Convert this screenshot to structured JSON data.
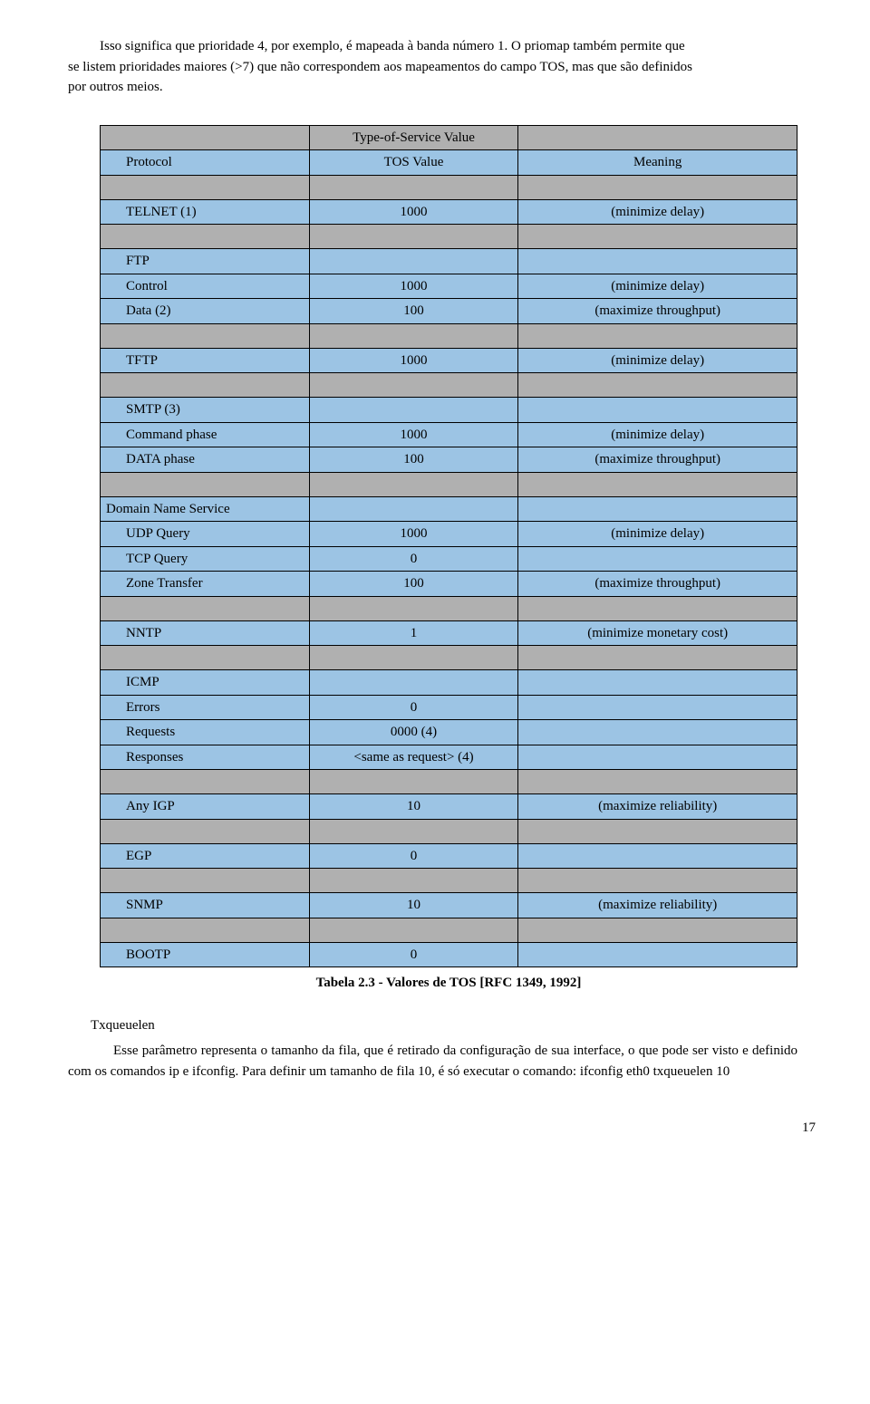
{
  "intro": {
    "l1": "Isso significa que prioridade 4, por exemplo, é mapeada à banda número 1. O priomap também permite que",
    "l2": "se listem prioridades maiores (>7) que não correspondem aos mapeamentos do campo TOS, mas que são definidos",
    "l3": "por outros meios."
  },
  "header": {
    "title": "Type-of-Service Value",
    "col1": "Protocol",
    "col2": "TOS Value",
    "col3": "Meaning"
  },
  "rows": {
    "telnet": {
      "c1": "TELNET (1)",
      "c2": "1000",
      "c3": "(minimize delay)"
    },
    "ftp": {
      "c1": "FTP"
    },
    "ftp_control": {
      "c1": "Control",
      "c2": "1000",
      "c3": "(minimize delay)"
    },
    "ftp_data": {
      "c1": "Data (2)",
      "c2": "100",
      "c3": "(maximize throughput)"
    },
    "tftp": {
      "c1": "TFTP",
      "c2": "1000",
      "c3": "(minimize delay)"
    },
    "smtp": {
      "c1": "SMTP (3)"
    },
    "smtp_cmd": {
      "c1": "Command phase",
      "c2": "1000",
      "c3": "(minimize delay)"
    },
    "smtp_data": {
      "c1": "DATA phase",
      "c2": "100",
      "c3": "(maximize throughput)"
    },
    "dns": {
      "c1": "Domain Name Service"
    },
    "dns_udp": {
      "c1": "UDP Query",
      "c2": "1000",
      "c3": "(minimize delay)"
    },
    "dns_tcp": {
      "c1": "TCP Query",
      "c2": "0",
      "c3": ""
    },
    "dns_zone": {
      "c1": "Zone Transfer",
      "c2": "100",
      "c3": "(maximize throughput)"
    },
    "nntp": {
      "c1": "NNTP",
      "c2": "1",
      "c3": "(minimize monetary cost)"
    },
    "icmp": {
      "c1": "ICMP"
    },
    "icmp_err": {
      "c1": "Errors",
      "c2": "0",
      "c3": ""
    },
    "icmp_req": {
      "c1": "Requests",
      "c2": "0000 (4)",
      "c3": ""
    },
    "icmp_resp": {
      "c1": "Responses",
      "c2": "<same as request> (4)",
      "c3": ""
    },
    "anyigp": {
      "c1": "Any IGP",
      "c2": "10",
      "c3": "(maximize reliability)"
    },
    "egp": {
      "c1": "EGP",
      "c2": "0",
      "c3": ""
    },
    "snmp": {
      "c1": "SNMP",
      "c2": "10",
      "c3": "(maximize reliability)"
    },
    "bootp": {
      "c1": "BOOTP",
      "c2": "0",
      "c3": ""
    }
  },
  "caption": "Tabela 2.3 - Valores de TOS [RFC 1349, 1992]",
  "section": {
    "title": "Txqueuelen",
    "p1": "Esse parâmetro representa o tamanho da fila, que é retirado da configuração de sua interface, o que pode ser visto e definido com os comandos ip e ifconfig. Para definir um tamanho de fila 10, é só executar o comando: ifconfig eth0 txqueuelen 10"
  },
  "page": "17"
}
